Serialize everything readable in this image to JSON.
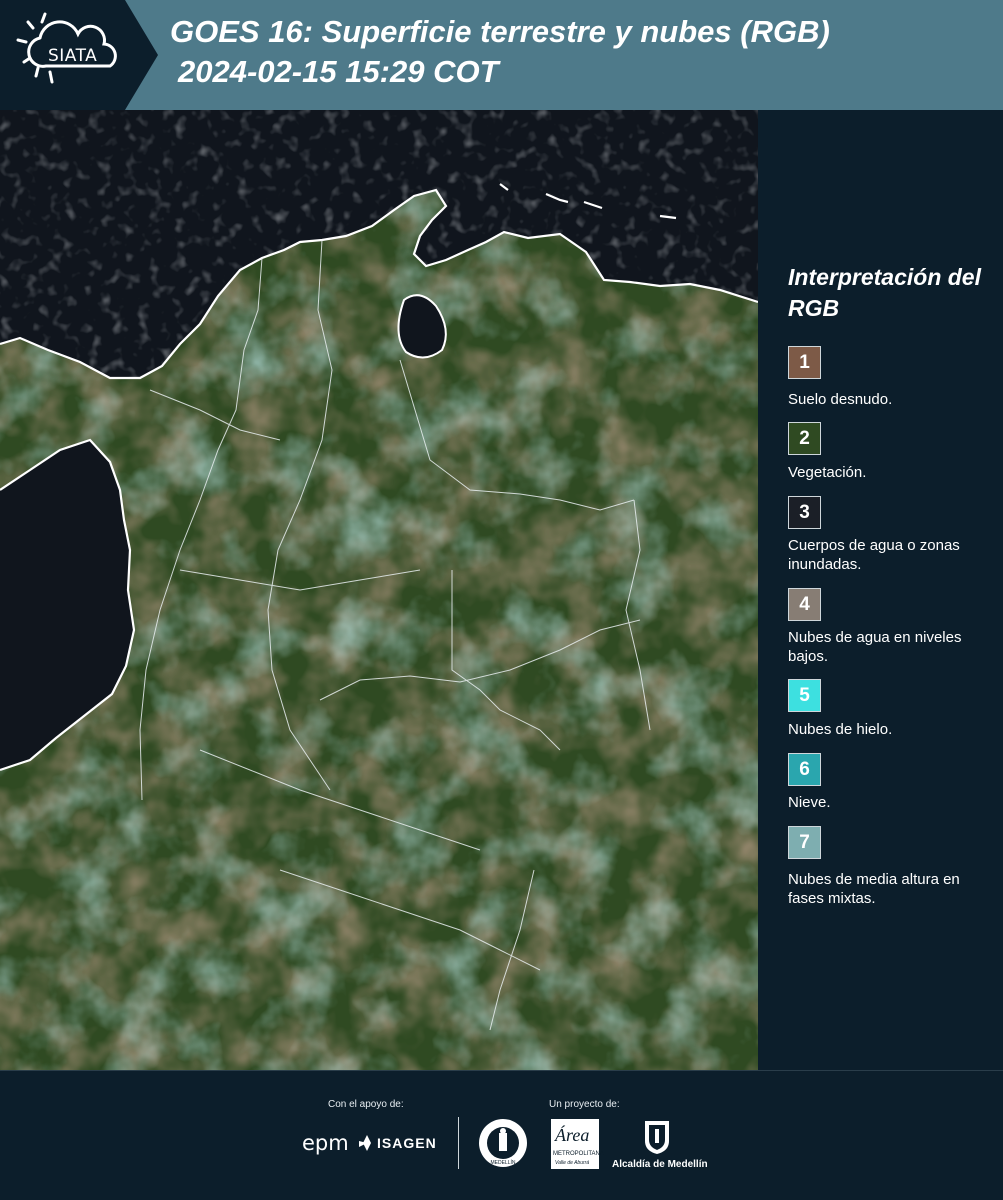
{
  "header": {
    "logo_text": "SIATA",
    "title_line1": "GOES 16: Superficie terrestre y nubes (RGB)",
    "title_line2": "2024-02-15 15:29 COT"
  },
  "legend": {
    "title": "Interpretación del RGB",
    "items": [
      {
        "number": "1",
        "label": "Suelo desnudo.",
        "color": "#7d5a47"
      },
      {
        "number": "2",
        "label": "Vegetación.",
        "color": "#2f4a22"
      },
      {
        "number": "3",
        "label": "Cuerpos de agua o zonas inundadas.",
        "color": "#1b1f27"
      },
      {
        "number": "4",
        "label": "Nubes de agua en niveles bajos.",
        "color": "#877d74"
      },
      {
        "number": "5",
        "label": "Nubes de hielo.",
        "color": "#3de0e0"
      },
      {
        "number": "6",
        "label": "Nieve.",
        "color": "#2aa6ae"
      },
      {
        "number": "7",
        "label": "Nubes de media altura en fases mixtas.",
        "color": "#7eaeb0"
      }
    ]
  },
  "footer": {
    "support_label": "Con el apoyo de:",
    "project_label": "Un proyecto de:",
    "epm": "epm",
    "isagen": "ISAGEN",
    "area_logo": "Área",
    "area_sub": "METROPOLITANA",
    "area_sub2": "Valle de Aburrá",
    "alcaldia": "Alcaldía de Medellín",
    "seal_text": "MEDELLÍN"
  },
  "colors": {
    "header_bg": "#4e7a8a",
    "panel_bg": "#0c1e2b",
    "ocean": "#10151d",
    "land": "#2f4a22",
    "coast": "#ffffff"
  }
}
